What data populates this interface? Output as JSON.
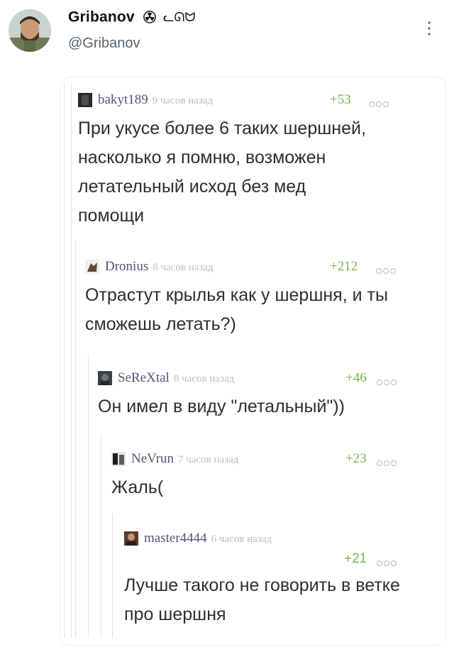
{
  "tweet": {
    "author_name": "Gribanov",
    "name_suffix": "ᓚᘏᗢ",
    "handle": "@Gribanov"
  },
  "comments": [
    {
      "user": "bakyt189",
      "time": "9 часов назад",
      "score": "+53",
      "text": "При укусе более 6 таких шершней, насколько я помню, возможен летательный исход без мед помощи"
    },
    {
      "user": "Dronius",
      "time": "8 часов назад",
      "score": "+212",
      "text": "Отрастут крылья как у шершня, и ты сможешь летать?)"
    },
    {
      "user": "SeReXtal",
      "time": "8 часов назад",
      "score": "+46",
      "text": "Он имел в виду \"летальный\"))"
    },
    {
      "user": "NeVrun",
      "time": "7 часов назад",
      "score": "+23",
      "text": "Жаль("
    },
    {
      "user": "master4444",
      "time": "6 часов назад",
      "score": "+21",
      "text": "Лучше такого не говорить в ветке про шершня"
    }
  ],
  "colors": {
    "username": "#4a5a74",
    "score": "#7bb34a",
    "time": "#b9bcc1"
  }
}
